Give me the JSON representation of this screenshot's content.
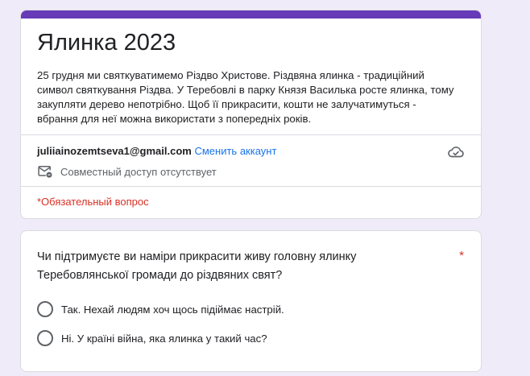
{
  "form": {
    "title": "Ялинка 2023",
    "description": "25 грудня ми святкуватимемо Різдво Христове. Різдвяна ялинка - традиційний символ святкування Різдва. У Теребовлі в парку Князя Василька росте ялинка, тому закупляти дерево непотрібно. Щоб її прикрасити, кошти не залучатимуться - вбрання для неї можна використати з попередніх років.",
    "accent_color": "#673ab7"
  },
  "account": {
    "email": "juliiainozemtseva1@gmail.com",
    "switch_label": "Сменить аккаунт",
    "sharing_status": "Совместный доступ отсутствует",
    "cloud_icon": "cloud-saved-icon",
    "share_icon": "mail-lock-icon"
  },
  "required_note": "*Обязательный вопрос",
  "question": {
    "text": "Чи підтримуєте ви наміри прикрасити живу головну ялинку Теребовлянської громади до різдвяних свят?",
    "required_mark": "*",
    "options": [
      {
        "label": "Так. Нехай людям хоч щось підіймає настрій."
      },
      {
        "label": "Ні. У країні війна, яка ялинка у такий час?"
      }
    ]
  }
}
